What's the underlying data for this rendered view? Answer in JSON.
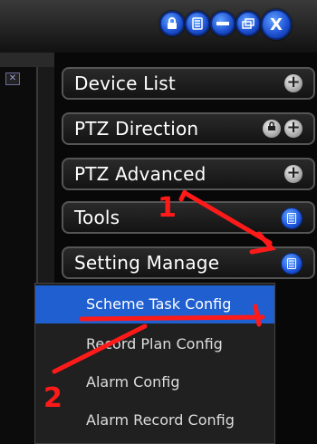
{
  "window_controls": {
    "lock_icon": "lock-icon",
    "list_icon": "list-icon",
    "minimize_icon": "minimize-icon",
    "restore_icon": "restore-icon",
    "close_label": "X"
  },
  "sidebar": {
    "items": [
      {
        "label": "Device List"
      },
      {
        "label": "PTZ Direction"
      },
      {
        "label": "PTZ Advanced"
      },
      {
        "label": "Tools"
      },
      {
        "label": "Setting Manage"
      }
    ]
  },
  "menu": {
    "items": [
      {
        "label": "Scheme Task Config",
        "selected": true
      },
      {
        "label": "Record Plan Config"
      },
      {
        "label": "Alarm Config"
      },
      {
        "label": "Alarm Record Config"
      }
    ]
  },
  "annotations": {
    "step1": "1",
    "step2": "2"
  },
  "colors": {
    "annotation": "#ff1a1a",
    "selection": "#1f5fd0",
    "accent_blue": "#1d55dd"
  }
}
